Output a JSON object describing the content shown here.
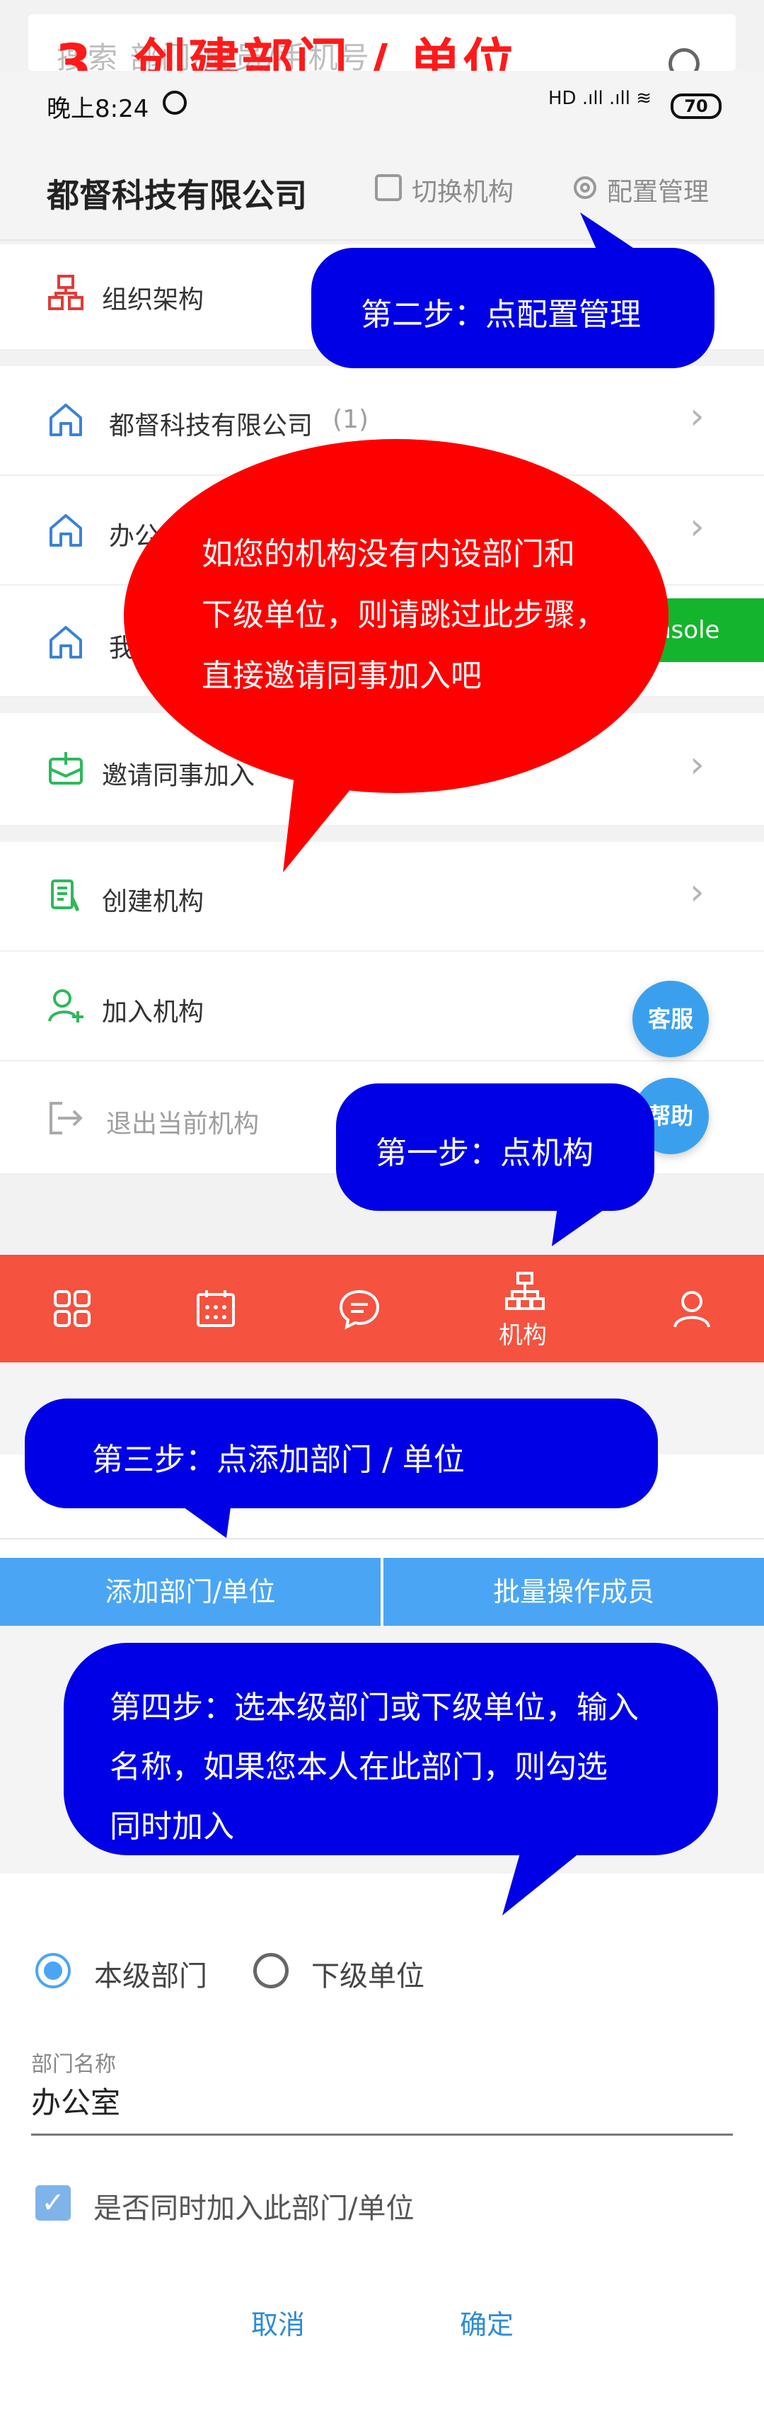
{
  "overlay_title": "3. 创建部门 / 单位",
  "search": {
    "placeholder": "搜索 部门/成员/手机号"
  },
  "status_bar": {
    "time": "晚上8:24",
    "signal": "HD .ıll .ıll ≋",
    "battery": "70"
  },
  "header": {
    "company": "都督科技有限公司",
    "switch_label": "切换机构",
    "config_label": "配置管理"
  },
  "list": {
    "org_structure": "组织架构",
    "company_row": "都督科技有限公司",
    "company_count": "(1)",
    "office_row": "办公",
    "my_row": "我",
    "invite": "邀请同事加入",
    "create_org": "创建机构",
    "join_org": "加入机构",
    "exit_org": "退出当前机构"
  },
  "console_button": "nsole",
  "fabs": {
    "service": "客服",
    "help": "帮助"
  },
  "tabbar": {
    "org_label": "机构"
  },
  "callouts": {
    "step1": "第一步：点机构",
    "step2": "第二步：点配置管理",
    "step3": "第三步：点添加部门 / 单位",
    "step4_line1": "第四步：选本级部门或下级单位，输入",
    "step4_line2": "名称，如果您本人在此部门，则勾选",
    "step4_line3": "同时加入",
    "note_line1": "如您的机构没有内设部门和",
    "note_line2": "下级单位，则请跳过此步骤，",
    "note_line3": "直接邀请同事加入吧"
  },
  "actions": {
    "add_dept": "添加部门/单位",
    "batch": "批量操作成员"
  },
  "form": {
    "radio_same": "本级部门",
    "radio_sub": "下级单位",
    "dept_name_label": "部门名称",
    "dept_name_value": "办公室",
    "join_checkbox": "是否同时加入此部门/单位",
    "cancel": "取消",
    "confirm": "确定"
  },
  "colors": {
    "accent_red": "#f5523f",
    "blue_button": "#4aa6f5",
    "callout_blue": "#0000e6",
    "callout_red": "#ff0000",
    "link_blue": "#2d8bd6"
  }
}
